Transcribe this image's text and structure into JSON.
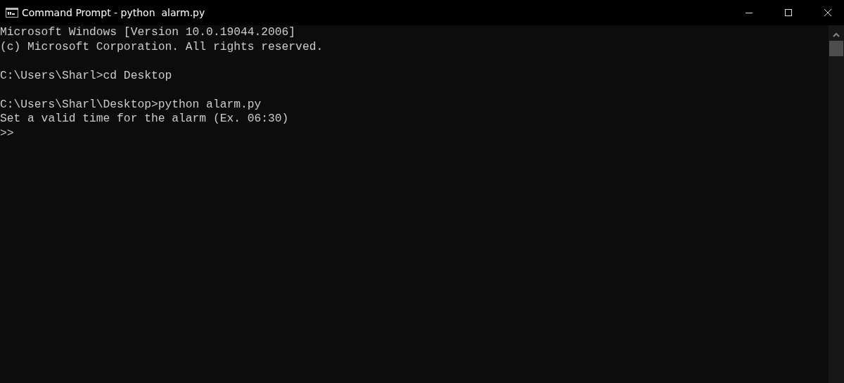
{
  "window": {
    "title": "Command Prompt - python  alarm.py"
  },
  "console": {
    "blocks": [
      [
        "Microsoft Windows [Version 10.0.19044.2006]",
        "(c) Microsoft Corporation. All rights reserved."
      ],
      [
        "C:\\Users\\Sharl>cd Desktop"
      ],
      [
        "C:\\Users\\Sharl\\Desktop>python alarm.py",
        "Set a valid time for the alarm (Ex. 06:30)",
        ">>"
      ]
    ]
  }
}
